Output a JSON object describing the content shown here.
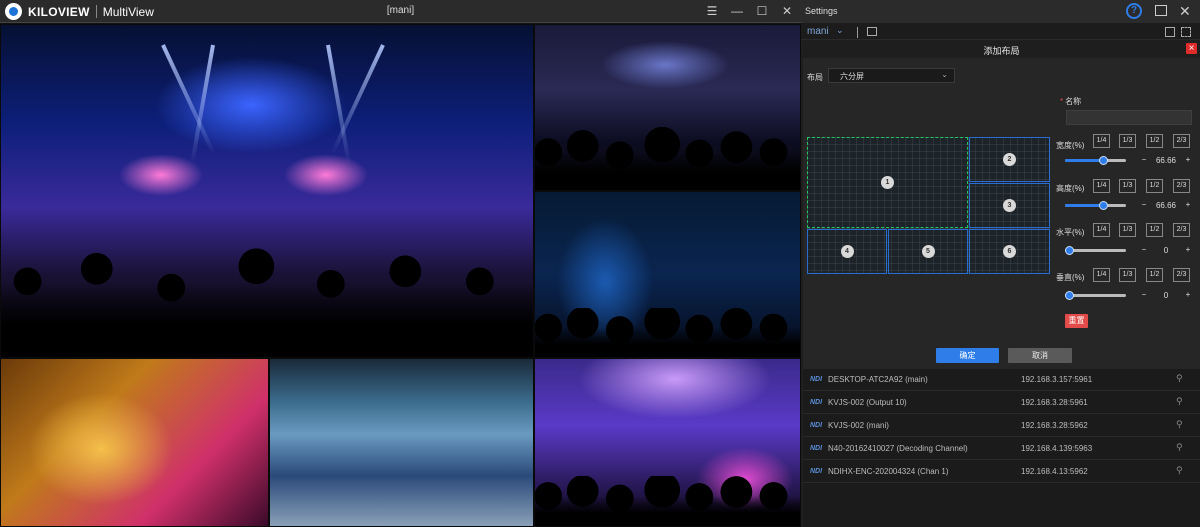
{
  "multiview": {
    "brand": "KILOVIEW",
    "app_name": "MultiView",
    "window_name": "[mani]",
    "controls": {
      "menu": "☰",
      "minimize": "—",
      "maximize": "☐",
      "close": "✕"
    }
  },
  "settings": {
    "title": "Settings",
    "help": "?",
    "close": "✕",
    "source_selector": "mani",
    "dialog": {
      "title": "添加布局",
      "layout_label": "布局",
      "layout_value": "六分屏",
      "name_label": "名称",
      "name_value": "",
      "cells": [
        "1",
        "2",
        "3",
        "4",
        "5",
        "6"
      ],
      "params": [
        {
          "label": "宽度(%)",
          "fractions": [
            "1/4",
            "1/3",
            "1/2",
            "2/3"
          ],
          "value": "66.66",
          "level": 0.66
        },
        {
          "label": "高度(%)",
          "fractions": [
            "1/4",
            "1/3",
            "1/2",
            "2/3"
          ],
          "value": "66.66",
          "level": 0.66
        },
        {
          "label": "水平(%)",
          "fractions": [
            "1/4",
            "1/3",
            "1/2",
            "2/3"
          ],
          "value": "0",
          "level": 0
        },
        {
          "label": "垂直(%)",
          "fractions": [
            "1/4",
            "1/3",
            "1/2",
            "2/3"
          ],
          "value": "0",
          "level": 0
        }
      ],
      "reset_label": "重置",
      "ok_label": "确定",
      "cancel_label": "取消"
    },
    "sources": [
      {
        "tag": "NDI",
        "name": "DESKTOP-ATC2A92 (main)",
        "ip": "192.168.3.157:5961"
      },
      {
        "tag": "NDI",
        "name": "KVJS-002 (Output 10)",
        "ip": "192.168.3.28:5961"
      },
      {
        "tag": "NDI",
        "name": "KVJS-002 (mani)",
        "ip": "192.168.3.28:5962"
      },
      {
        "tag": "NDI",
        "name": "N40-20162410027 (Decoding Channel)",
        "ip": "192.168.4.139:5963"
      },
      {
        "tag": "NDI",
        "name": "NDIHX-ENC-202004324 (Chan 1)",
        "ip": "192.168.4.13:5962"
      }
    ]
  },
  "colors": {
    "accent": "#2e7de8",
    "danger": "#e34a4a",
    "selection": "#22c55e"
  }
}
